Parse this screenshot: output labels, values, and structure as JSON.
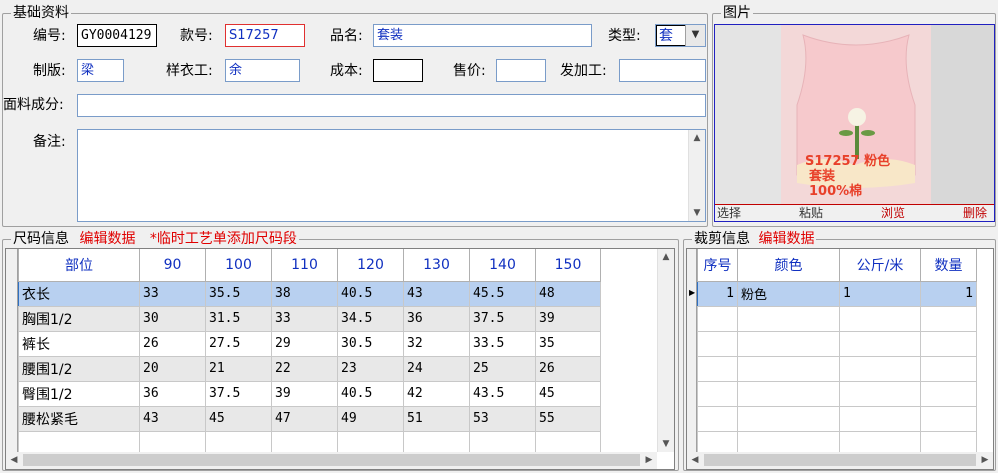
{
  "basic": {
    "title": "基础资料",
    "labels": {
      "code": "编号:",
      "style_no": "款号:",
      "product_name": "品名:",
      "type": "类型:",
      "pattern": "制版:",
      "sample_worker": "样衣工:",
      "cost": "成本:",
      "price": "售价:",
      "processor": "发加工:",
      "fabric": "面料成分:",
      "remark": "备注:"
    },
    "values": {
      "code": "GY0004129",
      "style_no": "S17257",
      "product_name": "套装",
      "type": "套",
      "pattern": "梁",
      "sample_worker": "余",
      "cost": "",
      "price": "",
      "processor": "",
      "fabric": "",
      "remark": ""
    }
  },
  "picture": {
    "title": "图片",
    "caption_lines": [
      "S17257 粉色",
      "套装",
      "100%棉"
    ],
    "actions": [
      "选择",
      "粘贴",
      "浏览",
      "删除"
    ]
  },
  "size": {
    "title": "尺码信息",
    "edit_label": "编辑数据",
    "note": "*临时工艺单添加尺码段",
    "columns": [
      "部位",
      "90",
      "100",
      "110",
      "120",
      "130",
      "140",
      "150"
    ],
    "rows": [
      [
        "衣长",
        "33",
        "35.5",
        "38",
        "40.5",
        "43",
        "45.5",
        "48"
      ],
      [
        "胸围1/2",
        "30",
        "31.5",
        "33",
        "34.5",
        "36",
        "37.5",
        "39"
      ],
      [
        "裤长",
        "26",
        "27.5",
        "29",
        "30.5",
        "32",
        "33.5",
        "35"
      ],
      [
        "腰围1/2",
        "20",
        "21",
        "22",
        "23",
        "24",
        "25",
        "26"
      ],
      [
        "臀围1/2",
        "36",
        "37.5",
        "39",
        "40.5",
        "42",
        "43.5",
        "45"
      ],
      [
        "腰松紧毛",
        "43",
        "45",
        "47",
        "49",
        "51",
        "53",
        "55"
      ]
    ]
  },
  "cut": {
    "title": "裁剪信息",
    "edit_label": "编辑数据",
    "columns": [
      "序号",
      "颜色",
      "公斤/米",
      "数量"
    ],
    "rows": [
      [
        "1",
        "粉色",
        "1",
        "1"
      ]
    ]
  },
  "colors": {
    "accent_red": "#e00000",
    "value_blue": "#1030c0",
    "selection": "#b8d0f0"
  }
}
